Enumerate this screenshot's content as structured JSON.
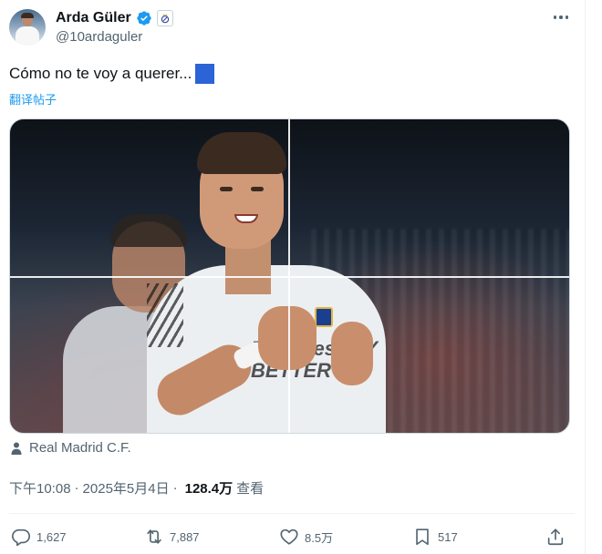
{
  "author": {
    "name": "Arda Güler",
    "handle": "@10ardaguler"
  },
  "tweet": {
    "text": "Cómo no te voy a querer...",
    "translate_label": "翻译帖子"
  },
  "location": {
    "label": "Real Madrid C.F."
  },
  "meta": {
    "time": "下午10:08",
    "separator": "·",
    "date": "2025年5月4日",
    "views": "128.4万",
    "views_label": "查看"
  },
  "actions": {
    "replies": "1,627",
    "retweets": "7,887",
    "likes": "8.5万",
    "bookmarks": "517"
  },
  "photo": {
    "jersey_text": "Emirates FLY BETTER"
  },
  "colors": {
    "accent": "#1d9bf0",
    "secondary_text": "#536471",
    "primary_text": "#0f1419",
    "emoji_square": "#2c63d6"
  },
  "icons": {
    "verified": "verified-badge-icon",
    "affiliate": "real-madrid-crest-icon",
    "more": "more-horizontal-icon",
    "location": "person-icon",
    "reply": "reply-icon",
    "retweet": "retweet-icon",
    "like": "heart-icon",
    "bookmark": "bookmark-icon",
    "share": "share-icon"
  }
}
